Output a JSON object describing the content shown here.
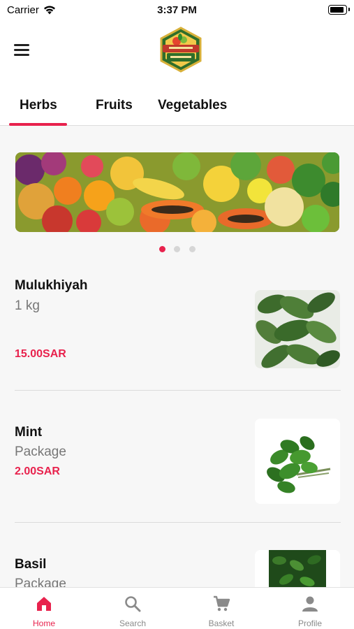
{
  "status_bar": {
    "carrier": "Carrier",
    "time": "3:37 PM"
  },
  "header": {
    "menu_icon": "hamburger-menu-icon",
    "logo": "store-logo"
  },
  "tabs": [
    {
      "label": "Herbs",
      "active": true
    },
    {
      "label": "Fruits",
      "active": false
    },
    {
      "label": "Vegetables",
      "active": false
    }
  ],
  "banner": {
    "image": "assorted-fruits-photo",
    "slides": 3,
    "active_slide": 1
  },
  "products": [
    {
      "name": "Mulukhiyah",
      "unit": "1 kg",
      "price": "15.00SAR",
      "image": "mulukhiyah-leaves-photo"
    },
    {
      "name": "Mint",
      "unit": "Package",
      "price": "2.00SAR",
      "image": "mint-bunch-photo"
    },
    {
      "name": "Basil",
      "unit": "Package",
      "price": "",
      "image": "basil-leaves-photo"
    }
  ],
  "bottom_nav": [
    {
      "label": "Home",
      "icon": "home-icon",
      "active": true
    },
    {
      "label": "Search",
      "icon": "search-icon",
      "active": false
    },
    {
      "label": "Basket",
      "icon": "cart-icon",
      "active": false
    },
    {
      "label": "Profile",
      "icon": "profile-icon",
      "active": false
    }
  ],
  "colors": {
    "accent": "#e8224d",
    "inactive": "#8a8a8a"
  }
}
